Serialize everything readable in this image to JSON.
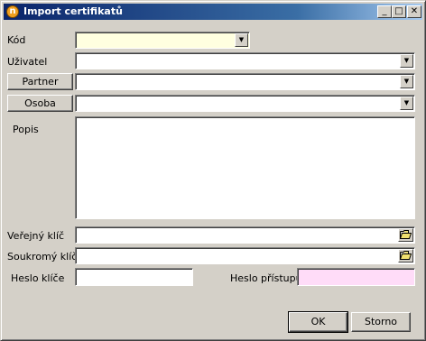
{
  "window": {
    "title": "Import certifikatů",
    "app_icon_glyph": "n",
    "min_glyph": "_",
    "max_glyph": "□",
    "close_glyph": "✕"
  },
  "form": {
    "kod_label": "Kód",
    "kod_value": "",
    "uzivatel_label": "Uživatel",
    "uzivatel_value": "",
    "partner_button": "Partner",
    "partner_value": "",
    "osoba_button": "Osoba",
    "osoba_value": "",
    "popis_label": "Popis",
    "popis_value": "",
    "verejny_label": "Veřejný klíč",
    "verejny_value": "",
    "soukromy_label": "Soukromý klíč",
    "soukromy_value": "",
    "heslo_klice_label": "Heslo klíče",
    "heslo_klice_value": "",
    "heslo_pristupu_label": "Heslo přístupu",
    "heslo_pristupu_value": ""
  },
  "buttons": {
    "ok_label": "OK",
    "storno_label": "Storno"
  },
  "colors": {
    "kod_field": "#ffffe0",
    "heslo_pristupu_field": "#ffdcf8",
    "titlebar": "#0a246a"
  },
  "icons": {
    "dropdown": "chevron-down-icon",
    "file_browse": "folder-open-icon"
  }
}
